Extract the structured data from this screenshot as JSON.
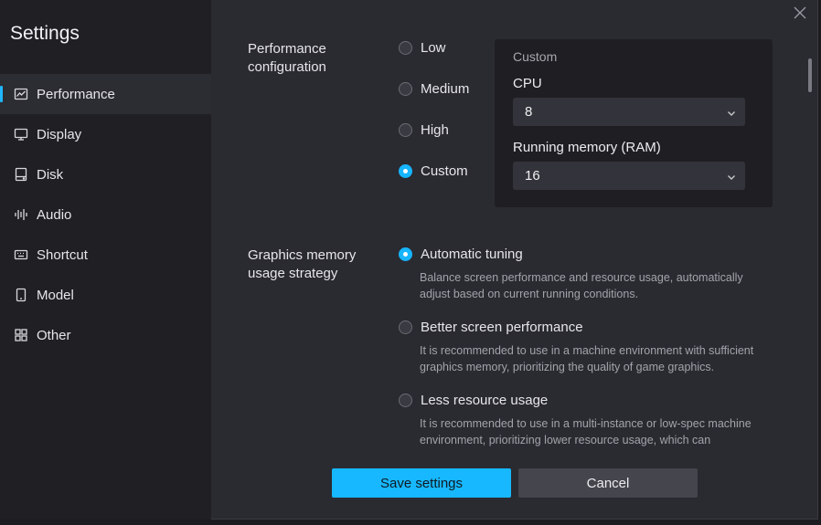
{
  "window": {
    "title": "Settings"
  },
  "sidebar": {
    "items": [
      {
        "label": "Performance",
        "icon": "performance-chart-icon",
        "active": true
      },
      {
        "label": "Display",
        "icon": "monitor-icon"
      },
      {
        "label": "Disk",
        "icon": "disk-icon"
      },
      {
        "label": "Audio",
        "icon": "audio-waveform-icon"
      },
      {
        "label": "Shortcut",
        "icon": "keyboard-icon"
      },
      {
        "label": "Model",
        "icon": "phone-icon"
      },
      {
        "label": "Other",
        "icon": "grid-icon"
      }
    ]
  },
  "performance": {
    "label": "Performance configuration",
    "options": [
      "Low",
      "Medium",
      "High",
      "Custom"
    ],
    "selected": "Custom",
    "custom": {
      "title": "Custom",
      "cpu_label": "CPU",
      "cpu_value": "8",
      "ram_label": "Running memory (RAM)",
      "ram_value": "16"
    }
  },
  "graphics": {
    "label": "Graphics memory usage strategy",
    "selected": "Automatic tuning",
    "options": [
      {
        "title": "Automatic tuning",
        "desc": "Balance screen performance and resource usage, automatically adjust based on current running conditions."
      },
      {
        "title": "Better screen performance",
        "desc": "It is recommended to use in a machine environment with sufficient graphics memory, prioritizing the quality of game graphics."
      },
      {
        "title": "Less resource usage",
        "desc": "It is recommended to use in a multi-instance or low-spec machine environment, prioritizing lower resource usage, which can"
      }
    ]
  },
  "footer": {
    "save_label": "Save settings",
    "cancel_label": "Cancel"
  },
  "colors": {
    "accent": "#16b5ff",
    "sidebar_bg": "#202024",
    "content_bg": "#2a2a31"
  }
}
